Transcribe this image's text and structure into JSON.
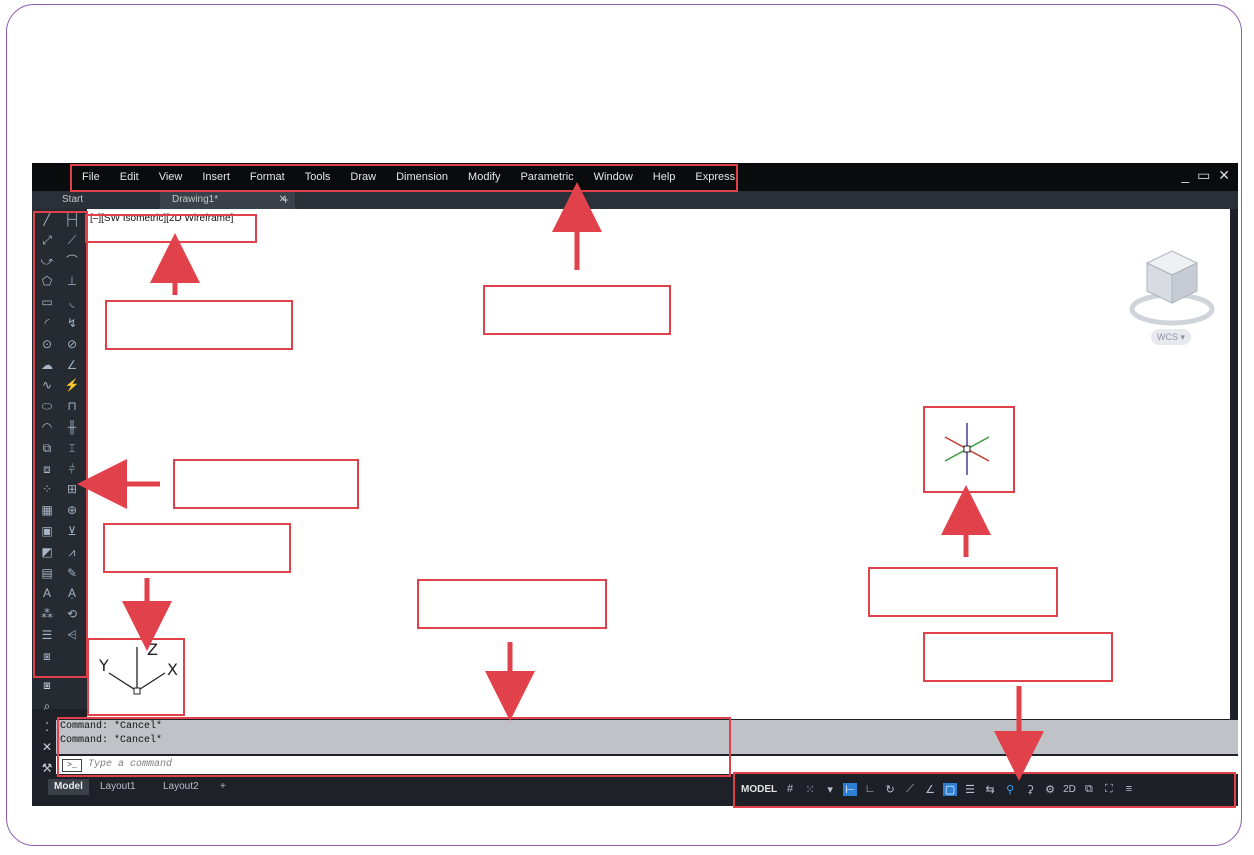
{
  "menu": {
    "items": [
      "File",
      "Edit",
      "View",
      "Insert",
      "Format",
      "Tools",
      "Draw",
      "Dimension",
      "Modify",
      "Parametric",
      "Window",
      "Help",
      "Express"
    ],
    "window_controls": "_ ▭ ✕"
  },
  "tabs": {
    "start": "Start",
    "drawing": "Drawing1*",
    "close": "✕",
    "add": "+"
  },
  "viewport": {
    "label": "[–][SW Isometric][2D Wireframe]",
    "wcs": "WCS ▾",
    "ucs_labels": {
      "x": "X",
      "y": "Y",
      "z": "Z"
    }
  },
  "command": {
    "history": [
      "Command: *Cancel*",
      "Command: *Cancel*"
    ],
    "placeholder": "Type a command",
    "icon": ">_"
  },
  "layout_tabs": [
    "Model",
    "Layout1",
    "Layout2",
    "+"
  ],
  "status": {
    "model": "MODEL",
    "dims": "2D"
  },
  "colors": {
    "annotation": "#e0414a",
    "frame": "#8e5bb0",
    "active_blue": "#2d7fd3"
  },
  "icons": {
    "draw_tools": [
      "line-icon",
      "construction-line-icon",
      "polyline-icon",
      "polygon-icon",
      "rectangle-icon",
      "arc-icon",
      "circle-icon",
      "revision-cloud-icon",
      "spline-icon",
      "ellipse-icon",
      "ellipse-arc-icon",
      "insert-block-icon",
      "make-block-icon",
      "point-icon",
      "hatch-icon",
      "gradient-icon",
      "region-icon",
      "table-icon",
      "text-icon",
      "add-selected-icon"
    ],
    "dimension_tools": [
      "linear-dim-icon",
      "aligned-dim-icon",
      "arc-length-icon",
      "ordinate-icon",
      "radius-icon",
      "jogged-icon",
      "diameter-icon",
      "angular-icon",
      "quick-dim-icon",
      "baseline-icon",
      "continue-icon",
      "space-icon",
      "break-icon",
      "tolerance-icon",
      "center-mark-icon",
      "inspection-icon",
      "jogged-linear-icon",
      "dim-edit-icon",
      "dim-text-edit-icon",
      "dim-update-icon",
      "dim-style-icon"
    ]
  }
}
